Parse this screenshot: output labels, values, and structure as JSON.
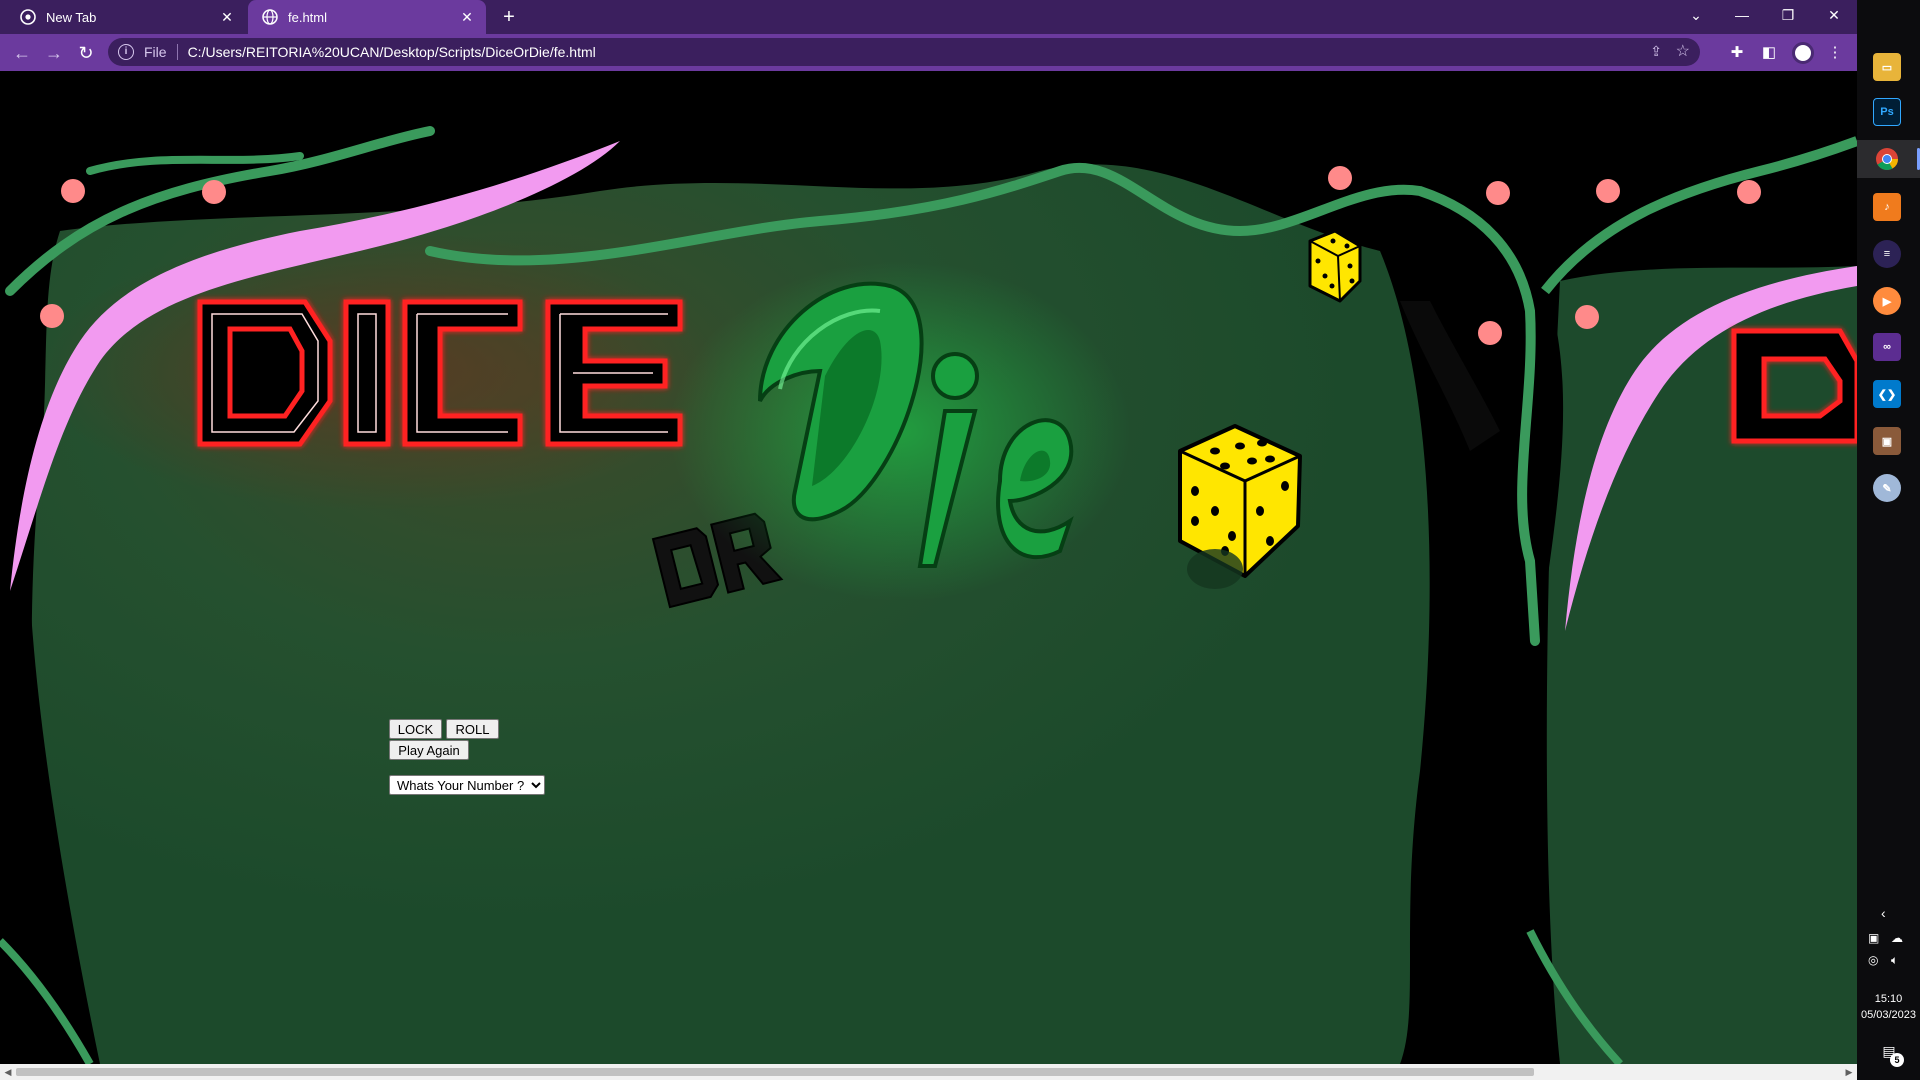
{
  "browser": {
    "tabs": [
      {
        "title": "New Tab",
        "active": false
      },
      {
        "title": "fe.html",
        "active": true
      }
    ],
    "omnibox": {
      "scheme_label": "File",
      "url": "C:/Users/REITORIA%20UCAN/Desktop/Scripts/DiceOrDie/fe.html"
    },
    "icons": {
      "back": "arrow-left-icon",
      "forward": "arrow-right-icon",
      "reload": "reload-icon",
      "share": "share-icon",
      "bookmark": "star-icon",
      "extensions": "puzzle-icon",
      "side_panel": "side-panel-icon",
      "menu": "kebab-menu-icon"
    },
    "theme_colors": {
      "tabstrip": "#3b1f5e",
      "toolbar": "#6b3a9e"
    }
  },
  "page": {
    "logo": {
      "word1": "DICE",
      "word2": "OR",
      "word3": "Die"
    },
    "controls": {
      "lock_label": "LOCK",
      "roll_label": "ROLL",
      "play_again_label": "Play Again",
      "number_select": {
        "selected": "Whats Your Number ?"
      }
    },
    "colors": {
      "table_green": "#1d4a2c",
      "vine_green": "#3a9a5c",
      "vine_pink": "#f29af0",
      "berry": "#ff8a8a",
      "neon_red": "#ff2020",
      "die_yellow": "#ffe600"
    }
  },
  "taskbar": {
    "apps": [
      "File Explorer",
      "Photoshop",
      "Google Chrome",
      "FL Studio",
      "Eclipse",
      "Media Player",
      "Visual Studio",
      "VS Code",
      "Photos",
      "Paint"
    ],
    "clock": {
      "time": "15:10",
      "date": "05/03/2023"
    },
    "notification_count": "5"
  }
}
